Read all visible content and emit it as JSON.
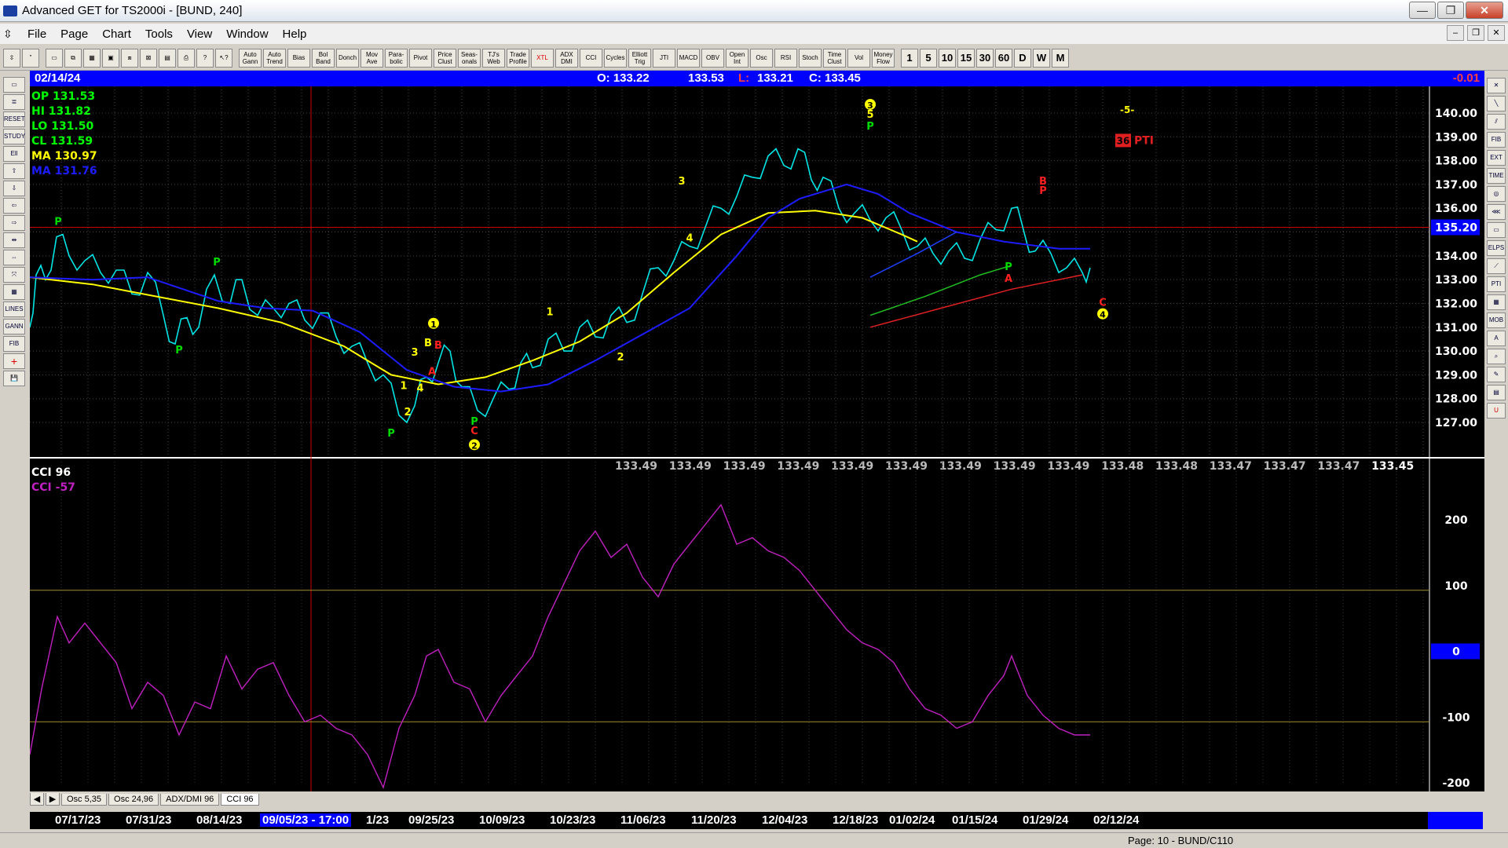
{
  "window": {
    "title": "Advanced GET for TS2000i - [BUND, 240]"
  },
  "menu": {
    "items": [
      "File",
      "Page",
      "Chart",
      "Tools",
      "View",
      "Window",
      "Help"
    ]
  },
  "toolbar": {
    "study_buttons": [
      "Auto Gann",
      "Auto Trend",
      "Bias",
      "Bol Band",
      "Donch",
      "Mov Ave",
      "Para-bolic",
      "Pivot",
      "Price Clust",
      "Seas-onals",
      "TJ's Web",
      "Trade Profile",
      "XTL",
      "ADX DMI",
      "CCI",
      "Cycles",
      "Elliott Trig",
      "JTI",
      "MACD",
      "OBV",
      "Open Int",
      "Osc",
      "RSI",
      "Stoch",
      "Time Clust",
      "Vol",
      "Money Flow"
    ],
    "intervals": [
      "1",
      "5",
      "10",
      "15",
      "30",
      "60",
      "D",
      "W",
      "M"
    ]
  },
  "infobar": {
    "date": "02/14/24",
    "open": "O: 133.22",
    "high": "133.53",
    "low_label": "L:",
    "low": "133.21",
    "close": "C: 133.45",
    "change": "-0.01"
  },
  "legend": {
    "op": "OP  131.53",
    "hi": "HI   131.82",
    "lo": "LO  131.50",
    "cl": "CL  131.59",
    "ma1": "MA  130.97",
    "ma2": "MA  131.76",
    "colors": {
      "op": "#00ff00",
      "ma1": "#ffff00",
      "ma2": "#0000ff"
    }
  },
  "price_axis": {
    "ticks": [
      "140.00",
      "139.00",
      "138.00",
      "137.00",
      "136.00",
      "135.20",
      "134.00",
      "133.00",
      "132.00",
      "131.00",
      "130.00",
      "129.00",
      "128.00",
      "127.00"
    ],
    "current": "135.20"
  },
  "bottom_values": [
    "133.49",
    "133.49",
    "133.49",
    "133.49",
    "133.49",
    "133.49",
    "133.49",
    "133.49",
    "133.49",
    "133.48",
    "133.48",
    "133.47",
    "133.47",
    "133.47",
    "133.45"
  ],
  "annotations": {
    "pti_number": "36",
    "pti_label": "PTI",
    "wave5": "-5-"
  },
  "cci": {
    "title": "CCI 96",
    "value": "CCI  -57",
    "ticks": [
      "200",
      "100",
      "0",
      "-100",
      "-200"
    ]
  },
  "tabs": [
    "Osc 5,35",
    "Osc 24,96",
    "ADX/DMI 96",
    "CCI 96"
  ],
  "dates": [
    "07/17/23",
    "07/31/23",
    "08/14/23",
    "09/05/23 - 17:00",
    "1/23",
    "09/25/23",
    "10/09/23",
    "10/23/23",
    "11/06/23",
    "11/20/23",
    "12/04/23",
    "12/18/23",
    "01/02/24",
    "01/15/24",
    "01/29/24",
    "02/12/24"
  ],
  "status": {
    "page": "Page: 10 - BUND/C110"
  }
}
